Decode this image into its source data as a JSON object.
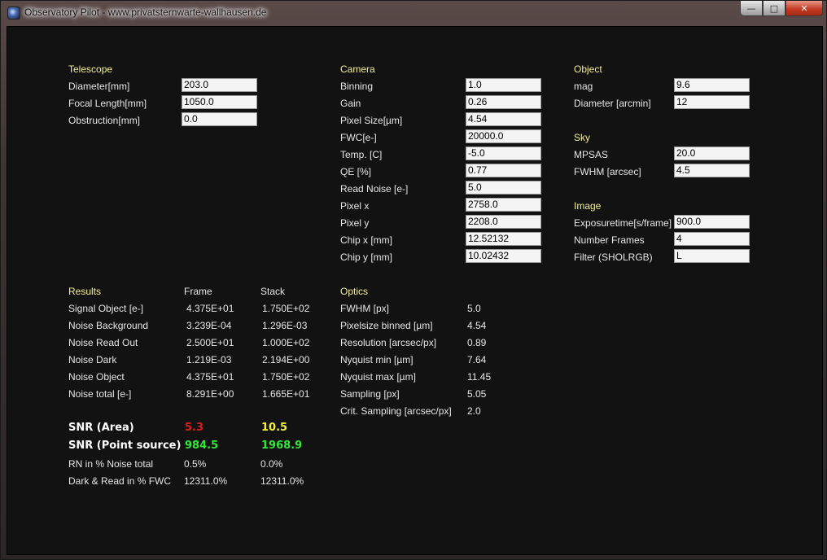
{
  "window": {
    "title": "Observatory Pilot - www.privatsternwarte-wallhausen.de",
    "min_glyph": "—",
    "max_glyph": "□",
    "close_glyph": "✕"
  },
  "colors": {
    "header": "#f2ee98",
    "red": "#d81f1f",
    "yellow": "#f6f03a",
    "green": "#34e83a"
  },
  "telescope": {
    "header": "Telescope",
    "fields": [
      {
        "label": "Diameter[mm]",
        "value": "203.0"
      },
      {
        "label": "Focal Length[mm]",
        "value": "1050.0"
      },
      {
        "label": "Obstruction[mm]",
        "value": "0.0"
      }
    ]
  },
  "camera": {
    "header": "Camera",
    "fields": [
      {
        "label": "Binning",
        "value": "1.0"
      },
      {
        "label": "Gain",
        "value": "0.26"
      },
      {
        "label": "Pixel Size[µm]",
        "value": "4.54"
      },
      {
        "label": "FWC[e-]",
        "value": "20000.0"
      },
      {
        "label": "Temp. [C]",
        "value": "-5.0"
      },
      {
        "label": "QE [%]",
        "value": "0.77"
      },
      {
        "label": "Read Noise [e-]",
        "value": "5.0"
      },
      {
        "label": "Pixel x",
        "value": "2758.0"
      },
      {
        "label": "Pixel y",
        "value": "2208.0"
      },
      {
        "label": "Chip x [mm]",
        "value": "12.52132"
      },
      {
        "label": "Chip y [mm]",
        "value": "10.02432"
      }
    ]
  },
  "object": {
    "header": "Object",
    "fields": [
      {
        "label": "mag",
        "value": "9.6"
      },
      {
        "label": "Diameter [arcmin]",
        "value": "12"
      }
    ]
  },
  "sky": {
    "header": "Sky",
    "fields": [
      {
        "label": "MPSAS",
        "value": "20.0"
      },
      {
        "label": "FWHM [arcsec]",
        "value": "4.5"
      }
    ]
  },
  "image": {
    "header": "Image",
    "fields": [
      {
        "label": "Exposuretime[s/frame]",
        "value": "900.0"
      },
      {
        "label": "Number Frames",
        "value": "4"
      },
      {
        "label": "Filter (SHOLRGB)",
        "value": "L"
      }
    ]
  },
  "results": {
    "header": "Results",
    "col_frame": "Frame",
    "col_stack": "Stack",
    "rows": [
      {
        "label": "Signal Object [e-]",
        "frame": "4.375E+01",
        "stack": "1.750E+02"
      },
      {
        "label": "Noise Background",
        "frame": "3.239E-04",
        "stack": "1.296E-03"
      },
      {
        "label": "Noise Read Out",
        "frame": "2.500E+01",
        "stack": "1.000E+02"
      },
      {
        "label": "Noise Dark",
        "frame": "1.219E-03",
        "stack": "2.194E+00"
      },
      {
        "label": "Noise Object",
        "frame": "4.375E+01",
        "stack": "1.750E+02"
      },
      {
        "label": "Noise total [e-]",
        "frame": "8.291E+00",
        "stack": "1.665E+01"
      }
    ],
    "snr_area": {
      "label": "SNR (Area)",
      "frame": "5.3",
      "stack": "10.5"
    },
    "snr_point": {
      "label": "SNR (Point source)",
      "frame": "984.5",
      "stack": "1968.9"
    },
    "rn_pct": {
      "label": "RN in % Noise total",
      "frame": "0.5%",
      "stack": "0.0%"
    },
    "dark_read": {
      "label": "Dark & Read in % FWC",
      "frame": "12311.0%",
      "stack": "12311.0%"
    }
  },
  "optics": {
    "header": "Optics",
    "rows": [
      {
        "label": "FWHM [px]",
        "value": "5.0"
      },
      {
        "label": "Pixelsize binned [µm]",
        "value": "4.54"
      },
      {
        "label": "Resolution [arcsec/px]",
        "value": "0.89"
      },
      {
        "label": "Nyquist min [µm]",
        "value": "7.64"
      },
      {
        "label": "Nyquist max [µm]",
        "value": "11.45"
      },
      {
        "label": "Sampling [px]",
        "value": "5.05"
      },
      {
        "label": "Crit. Sampling [arcsec/px]",
        "value": "2.0"
      }
    ]
  }
}
